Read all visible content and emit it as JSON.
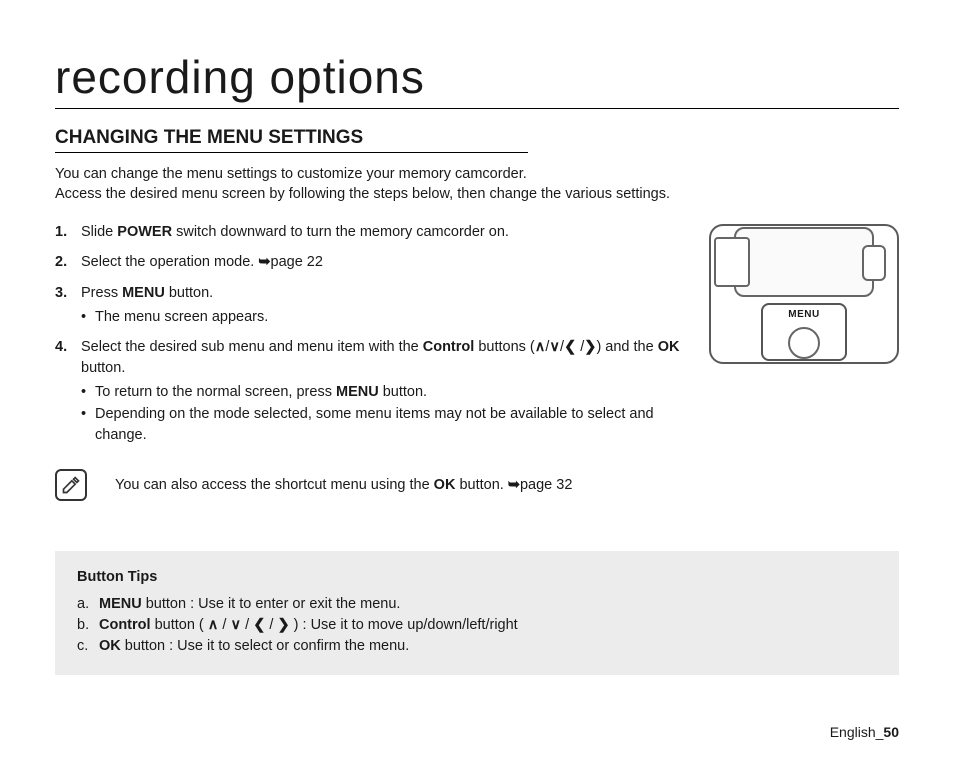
{
  "title": "recording options",
  "section": "CHANGING THE MENU SETTINGS",
  "intro_l1": "You can change the menu settings to customize your memory camcorder.",
  "intro_l2": "Access the desired menu screen by following the steps below, then change the various settings.",
  "steps": {
    "s1": {
      "num": "1.",
      "pre": "Slide ",
      "bold": "POWER",
      "post": " switch downward to turn the memory camcorder on."
    },
    "s2": {
      "num": "2.",
      "text": "Select the operation mode. ",
      "arrow": "➥",
      "page": "page 22"
    },
    "s3": {
      "num": "3.",
      "pre": "Press ",
      "bold": "MENU",
      "post": " button.",
      "sub1": "The menu screen appears."
    },
    "s4": {
      "num": "4.",
      "pre": "Select the desired sub menu and menu item with the ",
      "bold1": "Control",
      "mid": " buttons (",
      "chev_up": "∧",
      "sep": "/",
      "chev_dn": "∨",
      "chev_l": "❮",
      "chev_r": "❯",
      "mid2": ") and the ",
      "bold2": "OK",
      "post": " button.",
      "sub1_pre": "To return to the normal screen, press ",
      "sub1_bold": "MENU",
      "sub1_post": " button.",
      "sub2": "Depending on the mode selected, some menu items may not be available to select and change."
    }
  },
  "figure_label": "MENU",
  "note": {
    "pre": "You can also access the shortcut menu using the ",
    "bold": "OK",
    "post": " button. ",
    "arrow": "➥",
    "page": "page 32"
  },
  "tips": {
    "title": "Button Tips",
    "a": {
      "letter": "a.",
      "bold": "MENU",
      "text": " button : Use it to enter or exit the menu."
    },
    "b": {
      "letter": "b.",
      "bold": "Control",
      "pre": " button ( ",
      "u": "∧",
      "sep": " / ",
      "d": "∨",
      "l": "❮",
      "r": "❯",
      "post": " ) : Use it to move up/down/left/right"
    },
    "c": {
      "letter": "c.",
      "bold": "OK",
      "text": " button : Use it to select or confirm the menu."
    }
  },
  "footer": {
    "lang": "English",
    "sep": "_",
    "page": "50"
  }
}
